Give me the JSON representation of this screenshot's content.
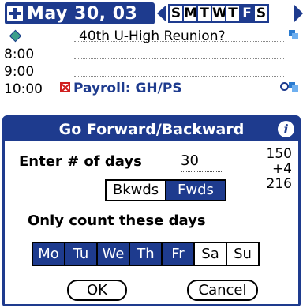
{
  "header": {
    "date": "May 30, 03",
    "weekdays": [
      "S",
      "M",
      "T",
      "W",
      "T",
      "F",
      "S"
    ],
    "selected_day_index": 5
  },
  "dayview": {
    "untimed_event": "40th U-High Reunion?",
    "times": [
      "8:00",
      "9:00",
      "10:00"
    ],
    "event_10": "Payroll: GH/PS"
  },
  "dialog": {
    "title": "Go Forward/Backward",
    "days_label": "Enter # of days",
    "days_value": "30",
    "side_numbers": [
      "150",
      "+4",
      "216"
    ],
    "direction": {
      "back": "Bkwds",
      "fwd": "Fwds",
      "selected": "fwd"
    },
    "only_label": "Only count these days",
    "days": [
      "Mo",
      "Tu",
      "We",
      "Th",
      "Fr",
      "Sa",
      "Su"
    ],
    "days_selected": [
      true,
      true,
      true,
      true,
      true,
      false,
      false
    ],
    "ok": "OK",
    "cancel": "Cancel"
  },
  "colors": {
    "accent": "#1e3b8e",
    "alert": "#d02020"
  }
}
